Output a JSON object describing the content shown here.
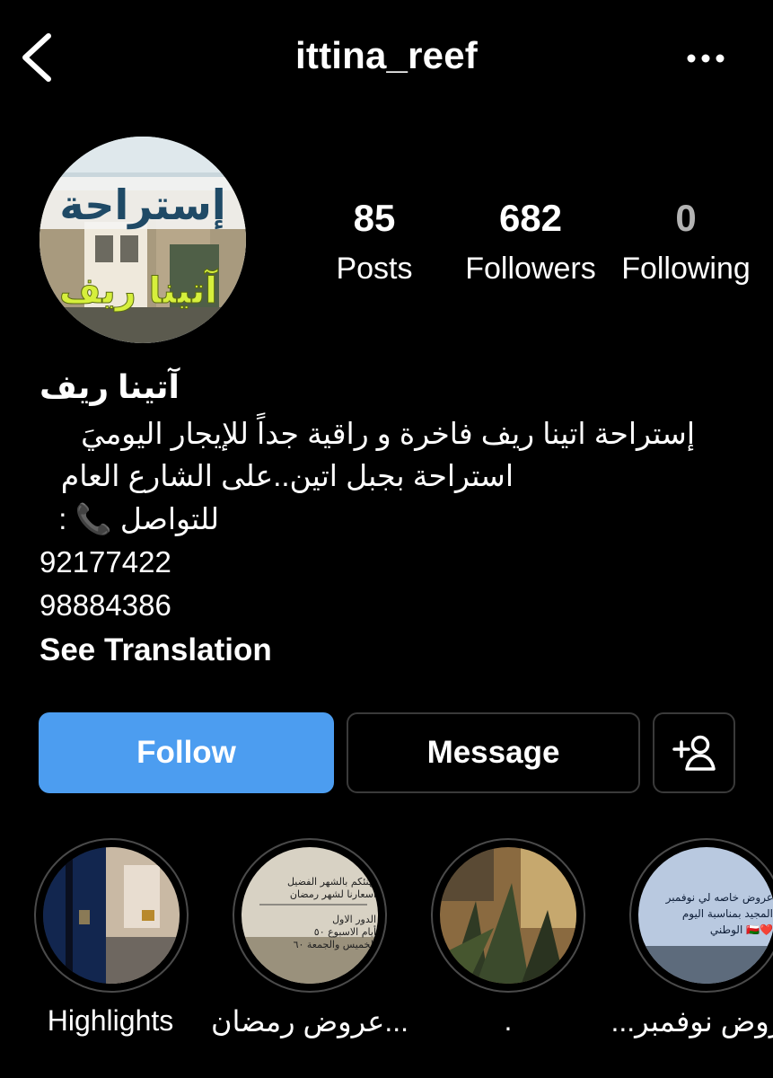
{
  "header": {
    "username": "ittina_reef"
  },
  "profile": {
    "avatar_text_top": "إستراحة",
    "avatar_text_bottom": "آتينا ريف",
    "stats": {
      "posts_count": "85",
      "posts_label": "Posts",
      "followers_count": "682",
      "followers_label": "Followers",
      "following_count": "0",
      "following_label": "Following"
    },
    "display_name": "آتينا ريف",
    "bio_lines": [
      "إستراحة اتينا ريف فاخرة و راقية جداً للإيجار اليوميَ",
      "استراحة بجبل اتين..على الشارع العام",
      "للتواصل 📞 :",
      "92177422",
      "98884386"
    ],
    "see_translation": "See Translation"
  },
  "actions": {
    "follow_label": "Follow",
    "message_label": "Message"
  },
  "highlights": [
    {
      "label": "Highlights"
    },
    {
      "label": "عروض رمضان...",
      "cover_lines": [
        "نهنئكم بالشهر الفضيل",
        "أسعارنا لشهر رمضان",
        "الدور الاول",
        "أيام الاسبوع ٥٠",
        "الخميس والجمعة ٦٠"
      ]
    },
    {
      "label": "."
    },
    {
      "label": "عروض نوفمبر...",
      "cover_lines": [
        "عروض خاصه لي نوفمبر",
        "المجيد بمناسبة اليوم",
        "الوطني 🇴🇲❤️"
      ]
    }
  ],
  "colors": {
    "background": "#000000",
    "follow_button": "#4c9df0",
    "border": "#3a3a3a"
  }
}
